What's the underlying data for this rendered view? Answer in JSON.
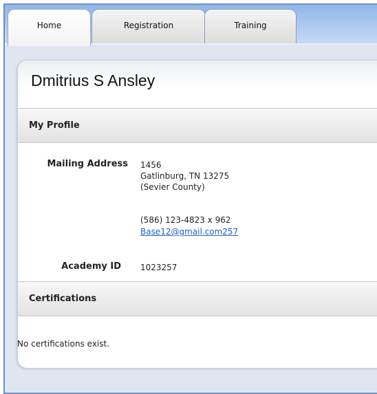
{
  "tabs": [
    {
      "label": "Home",
      "active": true
    },
    {
      "label": "Registration",
      "active": false
    },
    {
      "label": "Training",
      "active": false
    }
  ],
  "profile": {
    "name": "Dmitrius S Ansley",
    "section_title": "My Profile",
    "mailing_label": "Mailing Address",
    "address_line1": "1456",
    "address_line2": "Gatlinburg, TN 13275",
    "county": "(Sevier County)",
    "phone": "(586) 123-4823 x 962",
    "email": "Base12@gmail.com257",
    "academy_label": "Academy ID",
    "academy_id": "1023257"
  },
  "certifications": {
    "section_title": "Certifications",
    "empty_message": "No certifications exist."
  },
  "colors": {
    "tabbar": "#a9c7f0",
    "frame_border": "#6f8fc2",
    "link": "#1f5fcf"
  }
}
